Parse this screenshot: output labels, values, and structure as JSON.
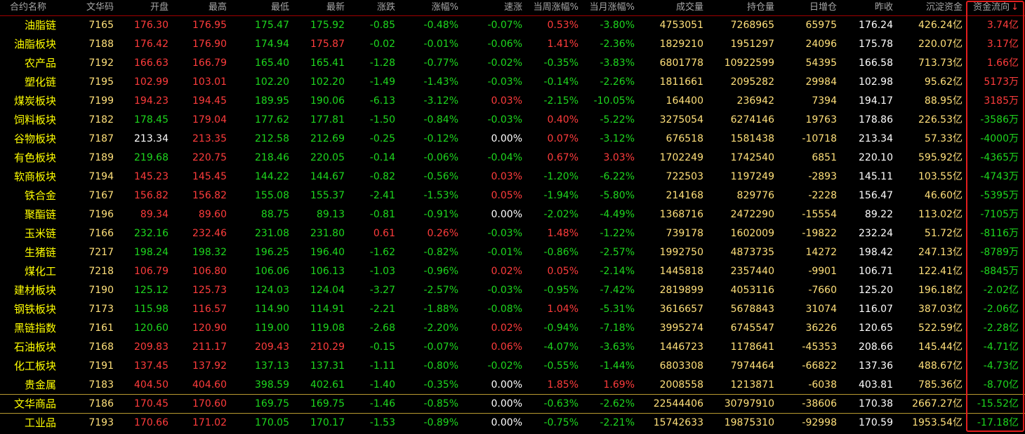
{
  "colors": {
    "up": "#ff3c3c",
    "down": "#1ed81e",
    "flat": "#ffffff",
    "yellow": "#ffff00",
    "yellow2": "#ffe07a",
    "header_text": "#a6a6a6",
    "sort_active": "#ff4040"
  },
  "headers": [
    "合约名称",
    "文华码",
    "开盘",
    "最高",
    "最低",
    "最新",
    "涨跌",
    "涨幅%",
    "速涨",
    "当周涨幅%",
    "当月涨幅%",
    "成交量",
    "持仓量",
    "日增仓",
    "昨收",
    "沉淀资金",
    "资金流向"
  ],
  "sort_icon": "down-arrow-icon",
  "sort_arrow_char": "↓",
  "rows": [
    {
      "name": "油脂链",
      "code": "7165",
      "open": "176.30",
      "high": "176.95",
      "low": "175.47",
      "last": "175.92",
      "chg": "-0.85",
      "pct": "-0.48%",
      "speed": "-0.07%",
      "week": "0.53%",
      "month": "-3.80%",
      "vol": "4753051",
      "oi": "7268965",
      "doi": "65975",
      "prev": "176.24",
      "fund": "426.24亿",
      "flow": "3.74亿"
    },
    {
      "name": "油脂板块",
      "code": "7188",
      "open": "176.42",
      "high": "176.90",
      "low": "174.94",
      "last": "175.87",
      "chg": "-0.02",
      "pct": "-0.01%",
      "speed": "-0.06%",
      "week": "1.41%",
      "month": "-2.36%",
      "vol": "1829210",
      "oi": "1951297",
      "doi": "24096",
      "prev": "175.78",
      "fund": "220.07亿",
      "flow": "3.17亿"
    },
    {
      "name": "农产品",
      "code": "7192",
      "open": "166.63",
      "high": "166.79",
      "low": "165.40",
      "last": "165.41",
      "chg": "-1.28",
      "pct": "-0.77%",
      "speed": "-0.02%",
      "week": "-0.35%",
      "month": "-3.83%",
      "vol": "6801778",
      "oi": "10922599",
      "doi": "54395",
      "prev": "166.58",
      "fund": "713.73亿",
      "flow": "1.66亿"
    },
    {
      "name": "塑化链",
      "code": "7195",
      "open": "102.99",
      "high": "103.01",
      "low": "102.20",
      "last": "102.20",
      "chg": "-1.49",
      "pct": "-1.43%",
      "speed": "-0.03%",
      "week": "-0.14%",
      "month": "-2.26%",
      "vol": "1811661",
      "oi": "2095282",
      "doi": "29984",
      "prev": "102.98",
      "fund": "95.62亿",
      "flow": "5173万"
    },
    {
      "name": "煤炭板块",
      "code": "7199",
      "open": "194.23",
      "high": "194.45",
      "low": "189.95",
      "last": "190.06",
      "chg": "-6.13",
      "pct": "-3.12%",
      "speed": "0.03%",
      "week": "-2.15%",
      "month": "-10.05%",
      "vol": "164400",
      "oi": "236942",
      "doi": "7394",
      "prev": "194.17",
      "fund": "88.95亿",
      "flow": "3185万"
    },
    {
      "name": "饲料板块",
      "code": "7182",
      "open": "178.45",
      "high": "179.04",
      "low": "177.62",
      "last": "177.81",
      "chg": "-1.50",
      "pct": "-0.84%",
      "speed": "-0.03%",
      "week": "0.40%",
      "month": "-5.22%",
      "vol": "3275054",
      "oi": "6274146",
      "doi": "19763",
      "prev": "178.86",
      "fund": "226.53亿",
      "flow": "-3586万"
    },
    {
      "name": "谷物板块",
      "code": "7187",
      "open": "213.34",
      "high": "213.35",
      "low": "212.58",
      "last": "212.69",
      "chg": "-0.25",
      "pct": "-0.12%",
      "speed": "0.00%",
      "week": "0.07%",
      "month": "-3.12%",
      "vol": "676518",
      "oi": "1581438",
      "doi": "-10718",
      "prev": "213.34",
      "fund": "57.33亿",
      "flow": "-4000万"
    },
    {
      "name": "有色板块",
      "code": "7189",
      "open": "219.68",
      "high": "220.75",
      "low": "218.46",
      "last": "220.05",
      "chg": "-0.14",
      "pct": "-0.06%",
      "speed": "-0.04%",
      "week": "0.67%",
      "month": "3.03%",
      "vol": "1702249",
      "oi": "1742540",
      "doi": "6851",
      "prev": "220.10",
      "fund": "595.92亿",
      "flow": "-4365万"
    },
    {
      "name": "软商板块",
      "code": "7194",
      "open": "145.23",
      "high": "145.45",
      "low": "144.22",
      "last": "144.67",
      "chg": "-0.82",
      "pct": "-0.56%",
      "speed": "0.03%",
      "week": "-1.20%",
      "month": "-6.22%",
      "vol": "722503",
      "oi": "1197249",
      "doi": "-2893",
      "prev": "145.11",
      "fund": "103.55亿",
      "flow": "-4743万"
    },
    {
      "name": "铁合金",
      "code": "7167",
      "open": "156.82",
      "high": "156.82",
      "low": "155.08",
      "last": "155.37",
      "chg": "-2.41",
      "pct": "-1.53%",
      "speed": "0.05%",
      "week": "-1.94%",
      "month": "-5.80%",
      "vol": "214168",
      "oi": "829776",
      "doi": "-2228",
      "prev": "156.47",
      "fund": "46.60亿",
      "flow": "-5395万"
    },
    {
      "name": "聚酯链",
      "code": "7196",
      "open": "89.34",
      "high": "89.60",
      "low": "88.75",
      "last": "89.13",
      "chg": "-0.81",
      "pct": "-0.91%",
      "speed": "0.00%",
      "week": "-2.02%",
      "month": "-4.49%",
      "vol": "1368716",
      "oi": "2472290",
      "doi": "-15554",
      "prev": "89.22",
      "fund": "113.02亿",
      "flow": "-7105万"
    },
    {
      "name": "玉米链",
      "code": "7166",
      "open": "232.16",
      "high": "232.46",
      "low": "231.08",
      "last": "231.80",
      "chg": "0.61",
      "pct": "0.26%",
      "speed": "-0.03%",
      "week": "1.48%",
      "month": "-1.22%",
      "vol": "739178",
      "oi": "1602009",
      "doi": "-19822",
      "prev": "232.24",
      "fund": "51.72亿",
      "flow": "-8116万"
    },
    {
      "name": "生猪链",
      "code": "7217",
      "open": "198.24",
      "high": "198.32",
      "low": "196.25",
      "last": "196.40",
      "chg": "-1.62",
      "pct": "-0.82%",
      "speed": "-0.01%",
      "week": "-0.86%",
      "month": "-2.57%",
      "vol": "1992750",
      "oi": "4873735",
      "doi": "14272",
      "prev": "198.42",
      "fund": "247.13亿",
      "flow": "-8789万"
    },
    {
      "name": "煤化工",
      "code": "7218",
      "open": "106.79",
      "high": "106.80",
      "low": "106.06",
      "last": "106.13",
      "chg": "-1.03",
      "pct": "-0.96%",
      "speed": "0.02%",
      "week": "0.05%",
      "month": "-2.14%",
      "vol": "1445818",
      "oi": "2357440",
      "doi": "-9901",
      "prev": "106.71",
      "fund": "122.41亿",
      "flow": "-8845万"
    },
    {
      "name": "建材板块",
      "code": "7190",
      "open": "125.12",
      "high": "125.73",
      "low": "124.03",
      "last": "124.04",
      "chg": "-3.27",
      "pct": "-2.57%",
      "speed": "-0.03%",
      "week": "-0.95%",
      "month": "-7.42%",
      "vol": "2819899",
      "oi": "4053116",
      "doi": "-7660",
      "prev": "125.20",
      "fund": "196.18亿",
      "flow": "-2.02亿"
    },
    {
      "name": "钢铁板块",
      "code": "7173",
      "open": "115.98",
      "high": "116.57",
      "low": "114.90",
      "last": "114.91",
      "chg": "-2.21",
      "pct": "-1.88%",
      "speed": "-0.08%",
      "week": "1.04%",
      "month": "-5.31%",
      "vol": "3616657",
      "oi": "5678843",
      "doi": "31074",
      "prev": "116.07",
      "fund": "387.03亿",
      "flow": "-2.06亿"
    },
    {
      "name": "黑链指数",
      "code": "7161",
      "open": "120.60",
      "high": "120.90",
      "low": "119.00",
      "last": "119.08",
      "chg": "-2.68",
      "pct": "-2.20%",
      "speed": "0.02%",
      "week": "-0.94%",
      "month": "-7.18%",
      "vol": "3995274",
      "oi": "6745547",
      "doi": "36226",
      "prev": "120.65",
      "fund": "522.59亿",
      "flow": "-2.28亿"
    },
    {
      "name": "石油板块",
      "code": "7168",
      "open": "209.83",
      "high": "211.17",
      "low": "209.43",
      "last": "210.29",
      "chg": "-0.15",
      "pct": "-0.07%",
      "speed": "0.06%",
      "week": "-4.07%",
      "month": "-3.63%",
      "vol": "1446723",
      "oi": "1178641",
      "doi": "-45353",
      "prev": "208.66",
      "fund": "145.44亿",
      "flow": "-4.71亿"
    },
    {
      "name": "化工板块",
      "code": "7191",
      "open": "137.45",
      "high": "137.92",
      "low": "137.13",
      "last": "137.31",
      "chg": "-1.11",
      "pct": "-0.80%",
      "speed": "-0.02%",
      "week": "-0.55%",
      "month": "-1.44%",
      "vol": "6803308",
      "oi": "7974464",
      "doi": "-66822",
      "prev": "137.36",
      "fund": "488.67亿",
      "flow": "-4.73亿"
    },
    {
      "name": "贵金属",
      "code": "7183",
      "open": "404.50",
      "high": "404.60",
      "low": "398.59",
      "last": "402.61",
      "chg": "-1.40",
      "pct": "-0.35%",
      "speed": "0.00%",
      "week": "1.85%",
      "month": "1.69%",
      "vol": "2008558",
      "oi": "1213871",
      "doi": "-6038",
      "prev": "403.81",
      "fund": "785.36亿",
      "flow": "-8.70亿"
    },
    {
      "name": "文华商品",
      "code": "7186",
      "open": "170.45",
      "high": "170.60",
      "low": "169.75",
      "last": "169.75",
      "chg": "-1.46",
      "pct": "-0.85%",
      "speed": "0.00%",
      "week": "-0.63%",
      "month": "-2.62%",
      "vol": "22544406",
      "oi": "30797910",
      "doi": "-38606",
      "prev": "170.38",
      "fund": "2667.27亿",
      "flow": "-15.52亿"
    },
    {
      "name": "工业品",
      "code": "7193",
      "open": "170.66",
      "high": "171.02",
      "low": "170.05",
      "last": "170.17",
      "chg": "-1.53",
      "pct": "-0.89%",
      "speed": "0.00%",
      "week": "-0.75%",
      "month": "-2.21%",
      "vol": "15742633",
      "oi": "19875310",
      "doi": "-92998",
      "prev": "170.59",
      "fund": "1953.54亿",
      "flow": "-17.18亿"
    }
  ]
}
